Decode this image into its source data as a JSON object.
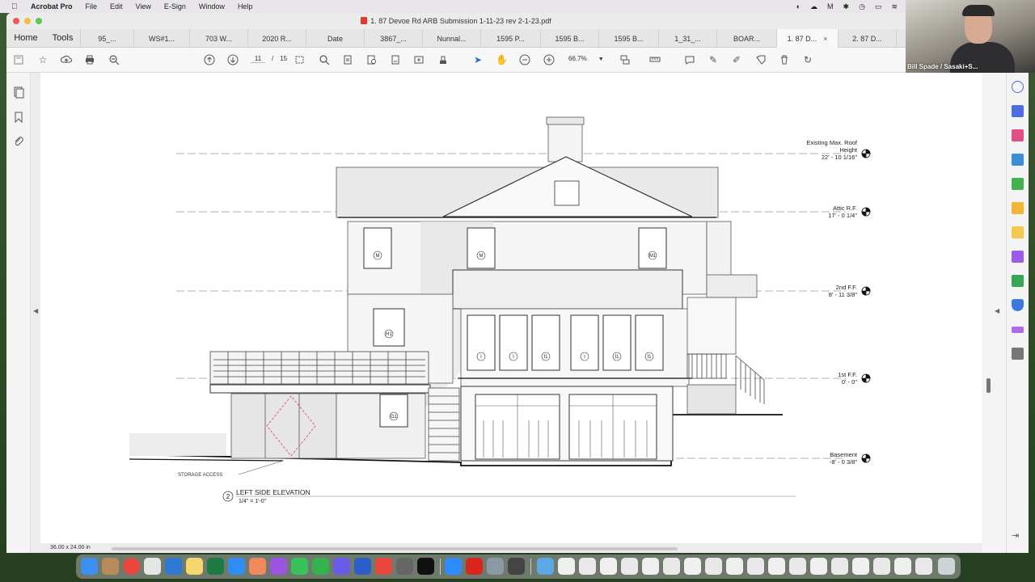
{
  "menubar": {
    "app": "Acrobat Pro",
    "items": [
      "File",
      "Edit",
      "View",
      "E-Sign",
      "Window",
      "Help"
    ]
  },
  "window": {
    "title": "1. 87 Devoe Rd ARB Submission 1-11-23 rev 2-1-23.pdf"
  },
  "tabbar": {
    "home": "Home",
    "tools": "Tools",
    "tabs": [
      {
        "label": "95_..."
      },
      {
        "label": "WS#1..."
      },
      {
        "label": "703 W..."
      },
      {
        "label": "2020 R..."
      },
      {
        "label": "Date"
      },
      {
        "label": "3867_..."
      },
      {
        "label": "Nunnal..."
      },
      {
        "label": "1595 P..."
      },
      {
        "label": "1595 B..."
      },
      {
        "label": "1595 B..."
      },
      {
        "label": "1_31_..."
      },
      {
        "label": "BOAR..."
      },
      {
        "label": "1. 87 D..."
      },
      {
        "label": "2. 87 D..."
      }
    ],
    "close_glyph": "×"
  },
  "toolbar": {
    "current_page": "11",
    "page_sep": "/",
    "total_pages": "15",
    "zoom": "66.7%"
  },
  "drawing": {
    "levels": [
      {
        "name": "Existing Max. Roof",
        "name2": "Height",
        "value": "22' - 10 1/16\""
      },
      {
        "name": "Attic R.F.",
        "value": "17' - 0 1/4\""
      },
      {
        "name": "2nd F.F.",
        "value": "8' - 11 3/8\""
      },
      {
        "name": "1st F.F.",
        "value": "0' - 0\""
      },
      {
        "name": "Basement",
        "value": "-8' - 0 3/8\""
      }
    ],
    "window_tags": [
      "M",
      "M",
      "M1",
      "H1",
      "I",
      "I",
      "I1",
      "I",
      "I1",
      "I1",
      "G1"
    ],
    "storage_label": "STORAGE ACCESS",
    "elevation_number": "2",
    "elevation_title": "LEFT SIDE ELEVATION",
    "elevation_scale": "1/4\" = 1'-0\""
  },
  "statusbar": {
    "page_size": "36.00 x 24.00 in"
  },
  "video": {
    "participant": "Bill Spade / Sasaki+S..."
  }
}
